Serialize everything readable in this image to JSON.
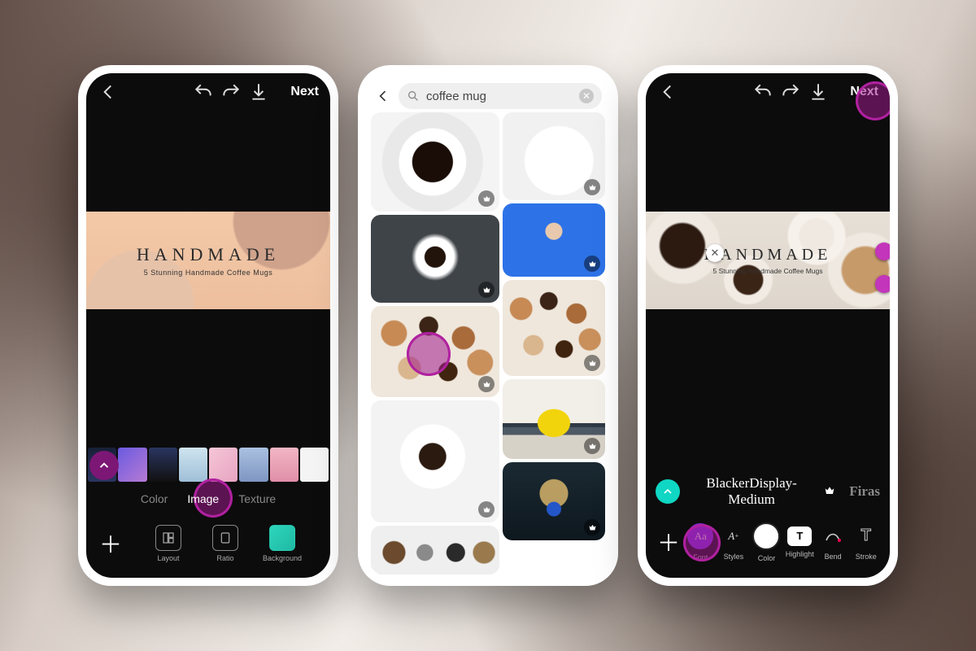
{
  "accent": "#8e1a8a",
  "phone1": {
    "next": "Next",
    "banner": {
      "title": "HANDMADE",
      "subtitle": "5 Stunning Handmade Coffee Mugs"
    },
    "bg_tabs": {
      "color": "Color",
      "image": "Image",
      "texture": "Texture"
    },
    "tools": {
      "layout": "Layout",
      "ratio": "Ratio",
      "background": "Background"
    }
  },
  "phone2": {
    "search": {
      "value": "coffee mug"
    }
  },
  "phone3": {
    "next": "Next",
    "banner": {
      "title": "HANDMADE",
      "subtitle": "5 Stunning Handmade Coffee Mugs"
    },
    "font": {
      "current": "BlackerDisplay-Medium",
      "alt": "Firas"
    },
    "tools": {
      "font": "Font",
      "styles": "Styles",
      "color": "Color",
      "highlight": "Highlight",
      "bend": "Bend",
      "stroke": "Stroke"
    }
  }
}
